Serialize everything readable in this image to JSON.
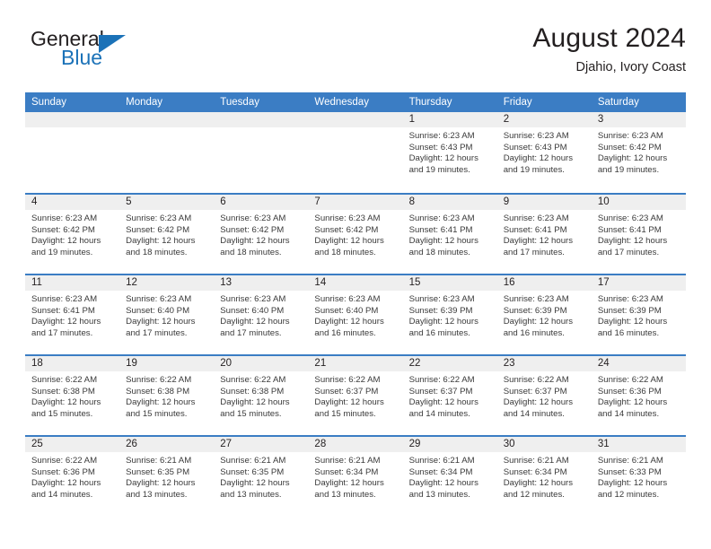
{
  "brand": {
    "name_part1": "General",
    "name_part2": "Blue",
    "triangle_icon": "triangle-icon",
    "color_primary": "#1b72b8",
    "color_text": "#231f20"
  },
  "header": {
    "title": "August 2024",
    "location": "Djahio, Ivory Coast"
  },
  "calendar": {
    "header_bg": "#3b7dc4",
    "band_bg": "#efefef",
    "weekday_headers": [
      "Sunday",
      "Monday",
      "Tuesday",
      "Wednesday",
      "Thursday",
      "Friday",
      "Saturday"
    ],
    "labels": {
      "sunrise": "Sunrise:",
      "sunset": "Sunset:",
      "daylight_prefix": "Daylight:",
      "daylight_join": "and"
    },
    "weeks": [
      [
        {
          "day": ""
        },
        {
          "day": ""
        },
        {
          "day": ""
        },
        {
          "day": ""
        },
        {
          "day": "1",
          "sunrise": "Sunrise: 6:23 AM",
          "sunset": "Sunset: 6:43 PM",
          "daylight_line1": "Daylight: 12 hours",
          "daylight_line2": "and 19 minutes."
        },
        {
          "day": "2",
          "sunrise": "Sunrise: 6:23 AM",
          "sunset": "Sunset: 6:43 PM",
          "daylight_line1": "Daylight: 12 hours",
          "daylight_line2": "and 19 minutes."
        },
        {
          "day": "3",
          "sunrise": "Sunrise: 6:23 AM",
          "sunset": "Sunset: 6:42 PM",
          "daylight_line1": "Daylight: 12 hours",
          "daylight_line2": "and 19 minutes."
        }
      ],
      [
        {
          "day": "4",
          "sunrise": "Sunrise: 6:23 AM",
          "sunset": "Sunset: 6:42 PM",
          "daylight_line1": "Daylight: 12 hours",
          "daylight_line2": "and 19 minutes."
        },
        {
          "day": "5",
          "sunrise": "Sunrise: 6:23 AM",
          "sunset": "Sunset: 6:42 PM",
          "daylight_line1": "Daylight: 12 hours",
          "daylight_line2": "and 18 minutes."
        },
        {
          "day": "6",
          "sunrise": "Sunrise: 6:23 AM",
          "sunset": "Sunset: 6:42 PM",
          "daylight_line1": "Daylight: 12 hours",
          "daylight_line2": "and 18 minutes."
        },
        {
          "day": "7",
          "sunrise": "Sunrise: 6:23 AM",
          "sunset": "Sunset: 6:42 PM",
          "daylight_line1": "Daylight: 12 hours",
          "daylight_line2": "and 18 minutes."
        },
        {
          "day": "8",
          "sunrise": "Sunrise: 6:23 AM",
          "sunset": "Sunset: 6:41 PM",
          "daylight_line1": "Daylight: 12 hours",
          "daylight_line2": "and 18 minutes."
        },
        {
          "day": "9",
          "sunrise": "Sunrise: 6:23 AM",
          "sunset": "Sunset: 6:41 PM",
          "daylight_line1": "Daylight: 12 hours",
          "daylight_line2": "and 17 minutes."
        },
        {
          "day": "10",
          "sunrise": "Sunrise: 6:23 AM",
          "sunset": "Sunset: 6:41 PM",
          "daylight_line1": "Daylight: 12 hours",
          "daylight_line2": "and 17 minutes."
        }
      ],
      [
        {
          "day": "11",
          "sunrise": "Sunrise: 6:23 AM",
          "sunset": "Sunset: 6:41 PM",
          "daylight_line1": "Daylight: 12 hours",
          "daylight_line2": "and 17 minutes."
        },
        {
          "day": "12",
          "sunrise": "Sunrise: 6:23 AM",
          "sunset": "Sunset: 6:40 PM",
          "daylight_line1": "Daylight: 12 hours",
          "daylight_line2": "and 17 minutes."
        },
        {
          "day": "13",
          "sunrise": "Sunrise: 6:23 AM",
          "sunset": "Sunset: 6:40 PM",
          "daylight_line1": "Daylight: 12 hours",
          "daylight_line2": "and 17 minutes."
        },
        {
          "day": "14",
          "sunrise": "Sunrise: 6:23 AM",
          "sunset": "Sunset: 6:40 PM",
          "daylight_line1": "Daylight: 12 hours",
          "daylight_line2": "and 16 minutes."
        },
        {
          "day": "15",
          "sunrise": "Sunrise: 6:23 AM",
          "sunset": "Sunset: 6:39 PM",
          "daylight_line1": "Daylight: 12 hours",
          "daylight_line2": "and 16 minutes."
        },
        {
          "day": "16",
          "sunrise": "Sunrise: 6:23 AM",
          "sunset": "Sunset: 6:39 PM",
          "daylight_line1": "Daylight: 12 hours",
          "daylight_line2": "and 16 minutes."
        },
        {
          "day": "17",
          "sunrise": "Sunrise: 6:23 AM",
          "sunset": "Sunset: 6:39 PM",
          "daylight_line1": "Daylight: 12 hours",
          "daylight_line2": "and 16 minutes."
        }
      ],
      [
        {
          "day": "18",
          "sunrise": "Sunrise: 6:22 AM",
          "sunset": "Sunset: 6:38 PM",
          "daylight_line1": "Daylight: 12 hours",
          "daylight_line2": "and 15 minutes."
        },
        {
          "day": "19",
          "sunrise": "Sunrise: 6:22 AM",
          "sunset": "Sunset: 6:38 PM",
          "daylight_line1": "Daylight: 12 hours",
          "daylight_line2": "and 15 minutes."
        },
        {
          "day": "20",
          "sunrise": "Sunrise: 6:22 AM",
          "sunset": "Sunset: 6:38 PM",
          "daylight_line1": "Daylight: 12 hours",
          "daylight_line2": "and 15 minutes."
        },
        {
          "day": "21",
          "sunrise": "Sunrise: 6:22 AM",
          "sunset": "Sunset: 6:37 PM",
          "daylight_line1": "Daylight: 12 hours",
          "daylight_line2": "and 15 minutes."
        },
        {
          "day": "22",
          "sunrise": "Sunrise: 6:22 AM",
          "sunset": "Sunset: 6:37 PM",
          "daylight_line1": "Daylight: 12 hours",
          "daylight_line2": "and 14 minutes."
        },
        {
          "day": "23",
          "sunrise": "Sunrise: 6:22 AM",
          "sunset": "Sunset: 6:37 PM",
          "daylight_line1": "Daylight: 12 hours",
          "daylight_line2": "and 14 minutes."
        },
        {
          "day": "24",
          "sunrise": "Sunrise: 6:22 AM",
          "sunset": "Sunset: 6:36 PM",
          "daylight_line1": "Daylight: 12 hours",
          "daylight_line2": "and 14 minutes."
        }
      ],
      [
        {
          "day": "25",
          "sunrise": "Sunrise: 6:22 AM",
          "sunset": "Sunset: 6:36 PM",
          "daylight_line1": "Daylight: 12 hours",
          "daylight_line2": "and 14 minutes."
        },
        {
          "day": "26",
          "sunrise": "Sunrise: 6:21 AM",
          "sunset": "Sunset: 6:35 PM",
          "daylight_line1": "Daylight: 12 hours",
          "daylight_line2": "and 13 minutes."
        },
        {
          "day": "27",
          "sunrise": "Sunrise: 6:21 AM",
          "sunset": "Sunset: 6:35 PM",
          "daylight_line1": "Daylight: 12 hours",
          "daylight_line2": "and 13 minutes."
        },
        {
          "day": "28",
          "sunrise": "Sunrise: 6:21 AM",
          "sunset": "Sunset: 6:34 PM",
          "daylight_line1": "Daylight: 12 hours",
          "daylight_line2": "and 13 minutes."
        },
        {
          "day": "29",
          "sunrise": "Sunrise: 6:21 AM",
          "sunset": "Sunset: 6:34 PM",
          "daylight_line1": "Daylight: 12 hours",
          "daylight_line2": "and 13 minutes."
        },
        {
          "day": "30",
          "sunrise": "Sunrise: 6:21 AM",
          "sunset": "Sunset: 6:34 PM",
          "daylight_line1": "Daylight: 12 hours",
          "daylight_line2": "and 12 minutes."
        },
        {
          "day": "31",
          "sunrise": "Sunrise: 6:21 AM",
          "sunset": "Sunset: 6:33 PM",
          "daylight_line1": "Daylight: 12 hours",
          "daylight_line2": "and 12 minutes."
        }
      ]
    ]
  }
}
